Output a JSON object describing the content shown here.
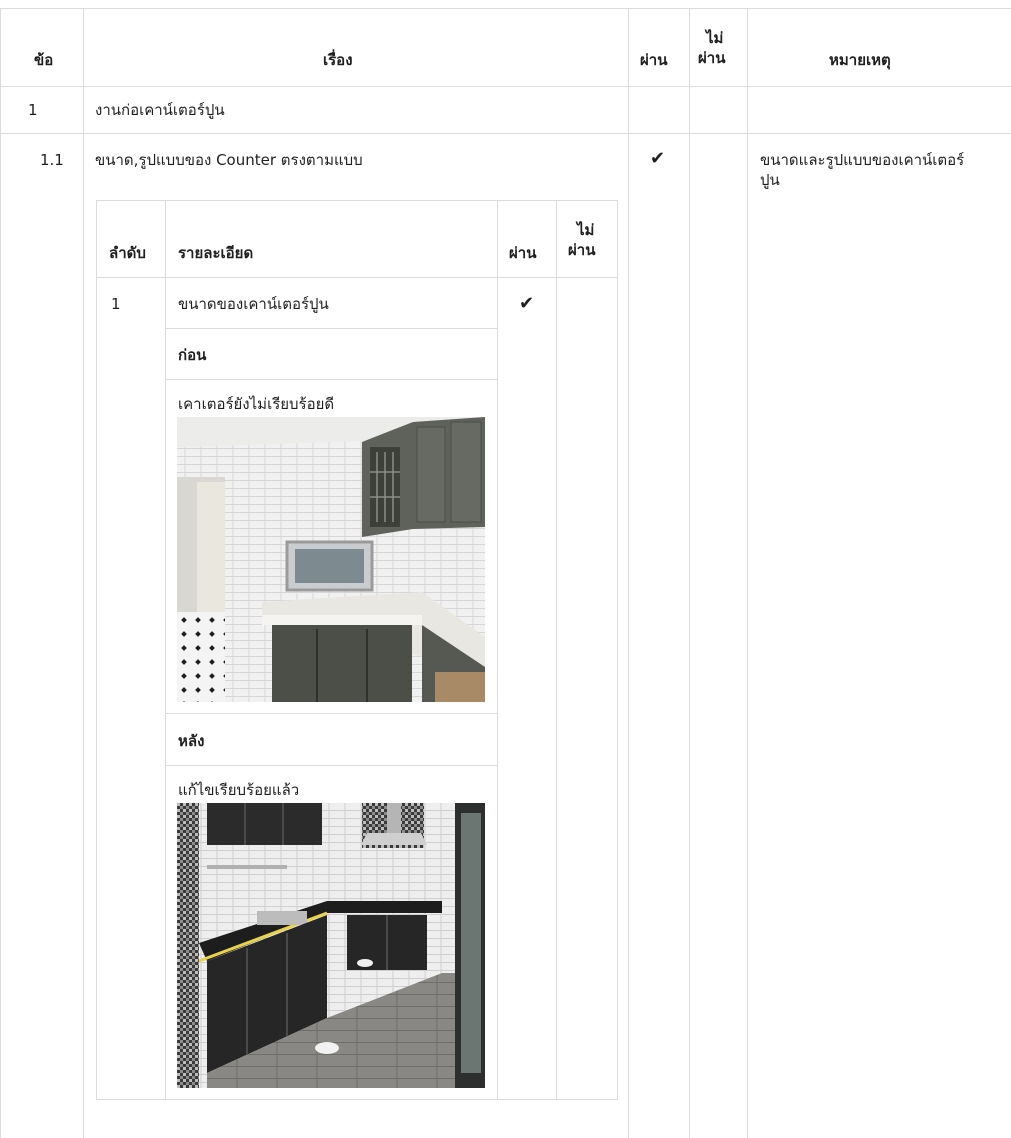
{
  "headers": {
    "no": "ข้อ",
    "topic": "เรื่อง",
    "pass": "ผ่าน",
    "fail_line1": "ไม่",
    "fail_line2": "ผ่าน",
    "remark": "หมายเหตุ"
  },
  "section": {
    "no": "1",
    "title": "งานก่อเคาน์เตอร์ปูน"
  },
  "item": {
    "no": "1.1",
    "title": "ขนาด,รูปแบบของ Counter ตรงตามแบบ",
    "pass_mark": "✔",
    "remark_line1": "ขนาดและรูปแบบของเคาน์เตอร์",
    "remark_line2": "ปูน"
  },
  "inner_table": {
    "headers": {
      "order": "ลำดับ",
      "detail": "รายละเอียด",
      "pass": "ผ่าน",
      "fail_line1": "ไม่",
      "fail_line2": "ผ่าน"
    },
    "row": {
      "order": "1",
      "detail": "ขนาดของเคาน์เตอร์ปูน",
      "pass_mark": "✔",
      "before_label": "ก่อน",
      "before_caption": "เคาเตอร์ยังไม่เรียบร้อยดี",
      "after_label": "หลัง",
      "after_caption": "แก้ไขเรียบร้อยแล้ว"
    }
  },
  "photos": {
    "before_icon": "kitchen-photo-before",
    "after_icon": "kitchen-photo-after"
  }
}
